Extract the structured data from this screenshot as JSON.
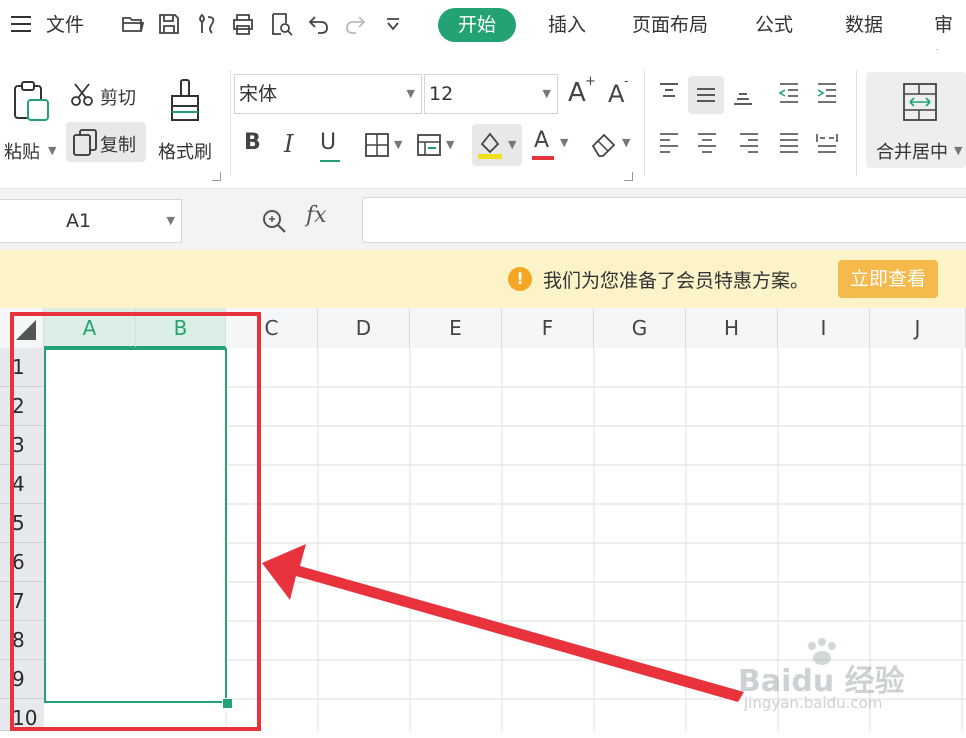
{
  "menubar": {
    "menu_label": "文件",
    "tabs": [
      {
        "label": "开始",
        "active": true
      },
      {
        "label": "插入",
        "active": false
      },
      {
        "label": "页面布局",
        "active": false
      },
      {
        "label": "公式",
        "active": false
      },
      {
        "label": "数据",
        "active": false
      },
      {
        "label": "审阅",
        "active": false
      }
    ],
    "quick_icons": [
      "open-folder-icon",
      "save-icon",
      "format-paint-icon",
      "print-icon",
      "print-preview-icon",
      "undo-icon",
      "redo-icon",
      "customize-dropdown-icon"
    ],
    "accent_color": "#23a373"
  },
  "ribbon": {
    "paste_label": "粘贴",
    "cut_label": "剪切",
    "copy_label": "复制",
    "format_painter_label": "格式刷",
    "font_name": "宋体",
    "font_size": "12",
    "increase_font_label": "A",
    "decrease_font_label": "A",
    "bold_label": "B",
    "italic_label": "I",
    "underline_label": "U",
    "font_color_label": "A",
    "merge_label": "合并居中"
  },
  "formula_bar": {
    "name_box": "A1",
    "fx_label": "fx",
    "formula_value": ""
  },
  "notice": {
    "message": "我们为您准备了会员特惠方案。",
    "button_label": "立即查看"
  },
  "grid": {
    "columns": [
      "A",
      "B",
      "C",
      "D",
      "E",
      "F",
      "G",
      "H",
      "I",
      "J"
    ],
    "rows": [
      "1",
      "2",
      "3",
      "4",
      "5",
      "6",
      "7",
      "8",
      "9",
      "10"
    ],
    "selection_color": "#23a373",
    "highlight_color": "#e8323c"
  },
  "watermark": {
    "brand": "Baidu 经验",
    "url": "jingyan.baidu.com"
  }
}
